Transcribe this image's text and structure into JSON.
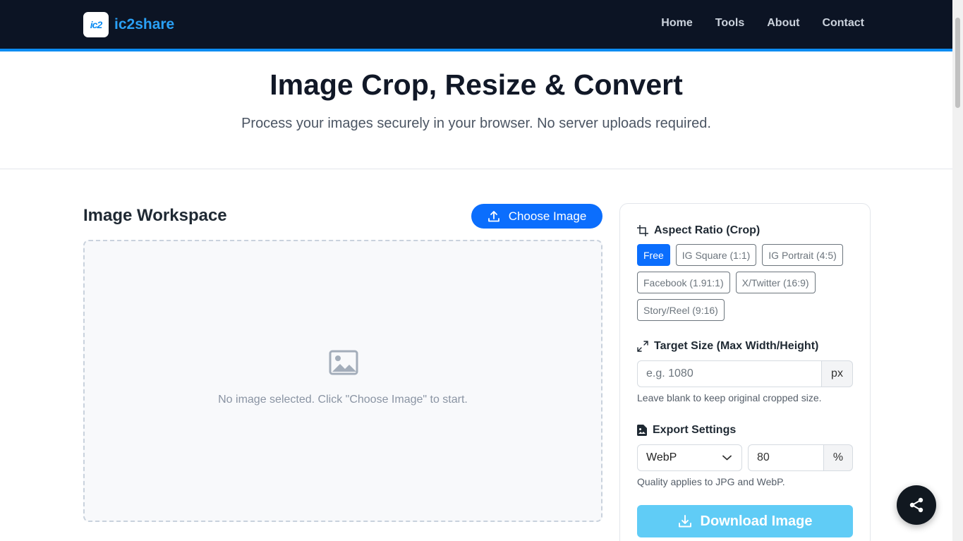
{
  "brand": {
    "logo_text": "ic2",
    "name": "ic2share"
  },
  "nav": [
    "Home",
    "Tools",
    "About",
    "Contact"
  ],
  "hero": {
    "title": "Image Crop, Resize & Convert",
    "subtitle": "Process your images securely in your browser. No server uploads required."
  },
  "workspace": {
    "title": "Image Workspace",
    "choose_label": "Choose Image",
    "empty_text": "No image selected. Click \"Choose Image\" to start."
  },
  "aspect": {
    "title": "Aspect Ratio (Crop)",
    "options": [
      "Free",
      "IG Square (1:1)",
      "IG Portrait (4:5)",
      "Facebook (1.91:1)",
      "X/Twitter (16:9)",
      "Story/Reel (9:16)"
    ],
    "selected": "Free"
  },
  "target_size": {
    "title": "Target Size (Max Width/Height)",
    "placeholder": "e.g. 1080",
    "unit": "px",
    "help": "Leave blank to keep original cropped size."
  },
  "export": {
    "title": "Export Settings",
    "format": "WebP",
    "quality": "80",
    "quality_unit": "%",
    "help": "Quality applies to JPG and WebP."
  },
  "download_label": "Download Image",
  "colors": {
    "primary": "#0b6efd",
    "nav_bg": "#0c1424",
    "download_bg": "#60ccf6",
    "brand_accent": "#2aa0f5"
  }
}
